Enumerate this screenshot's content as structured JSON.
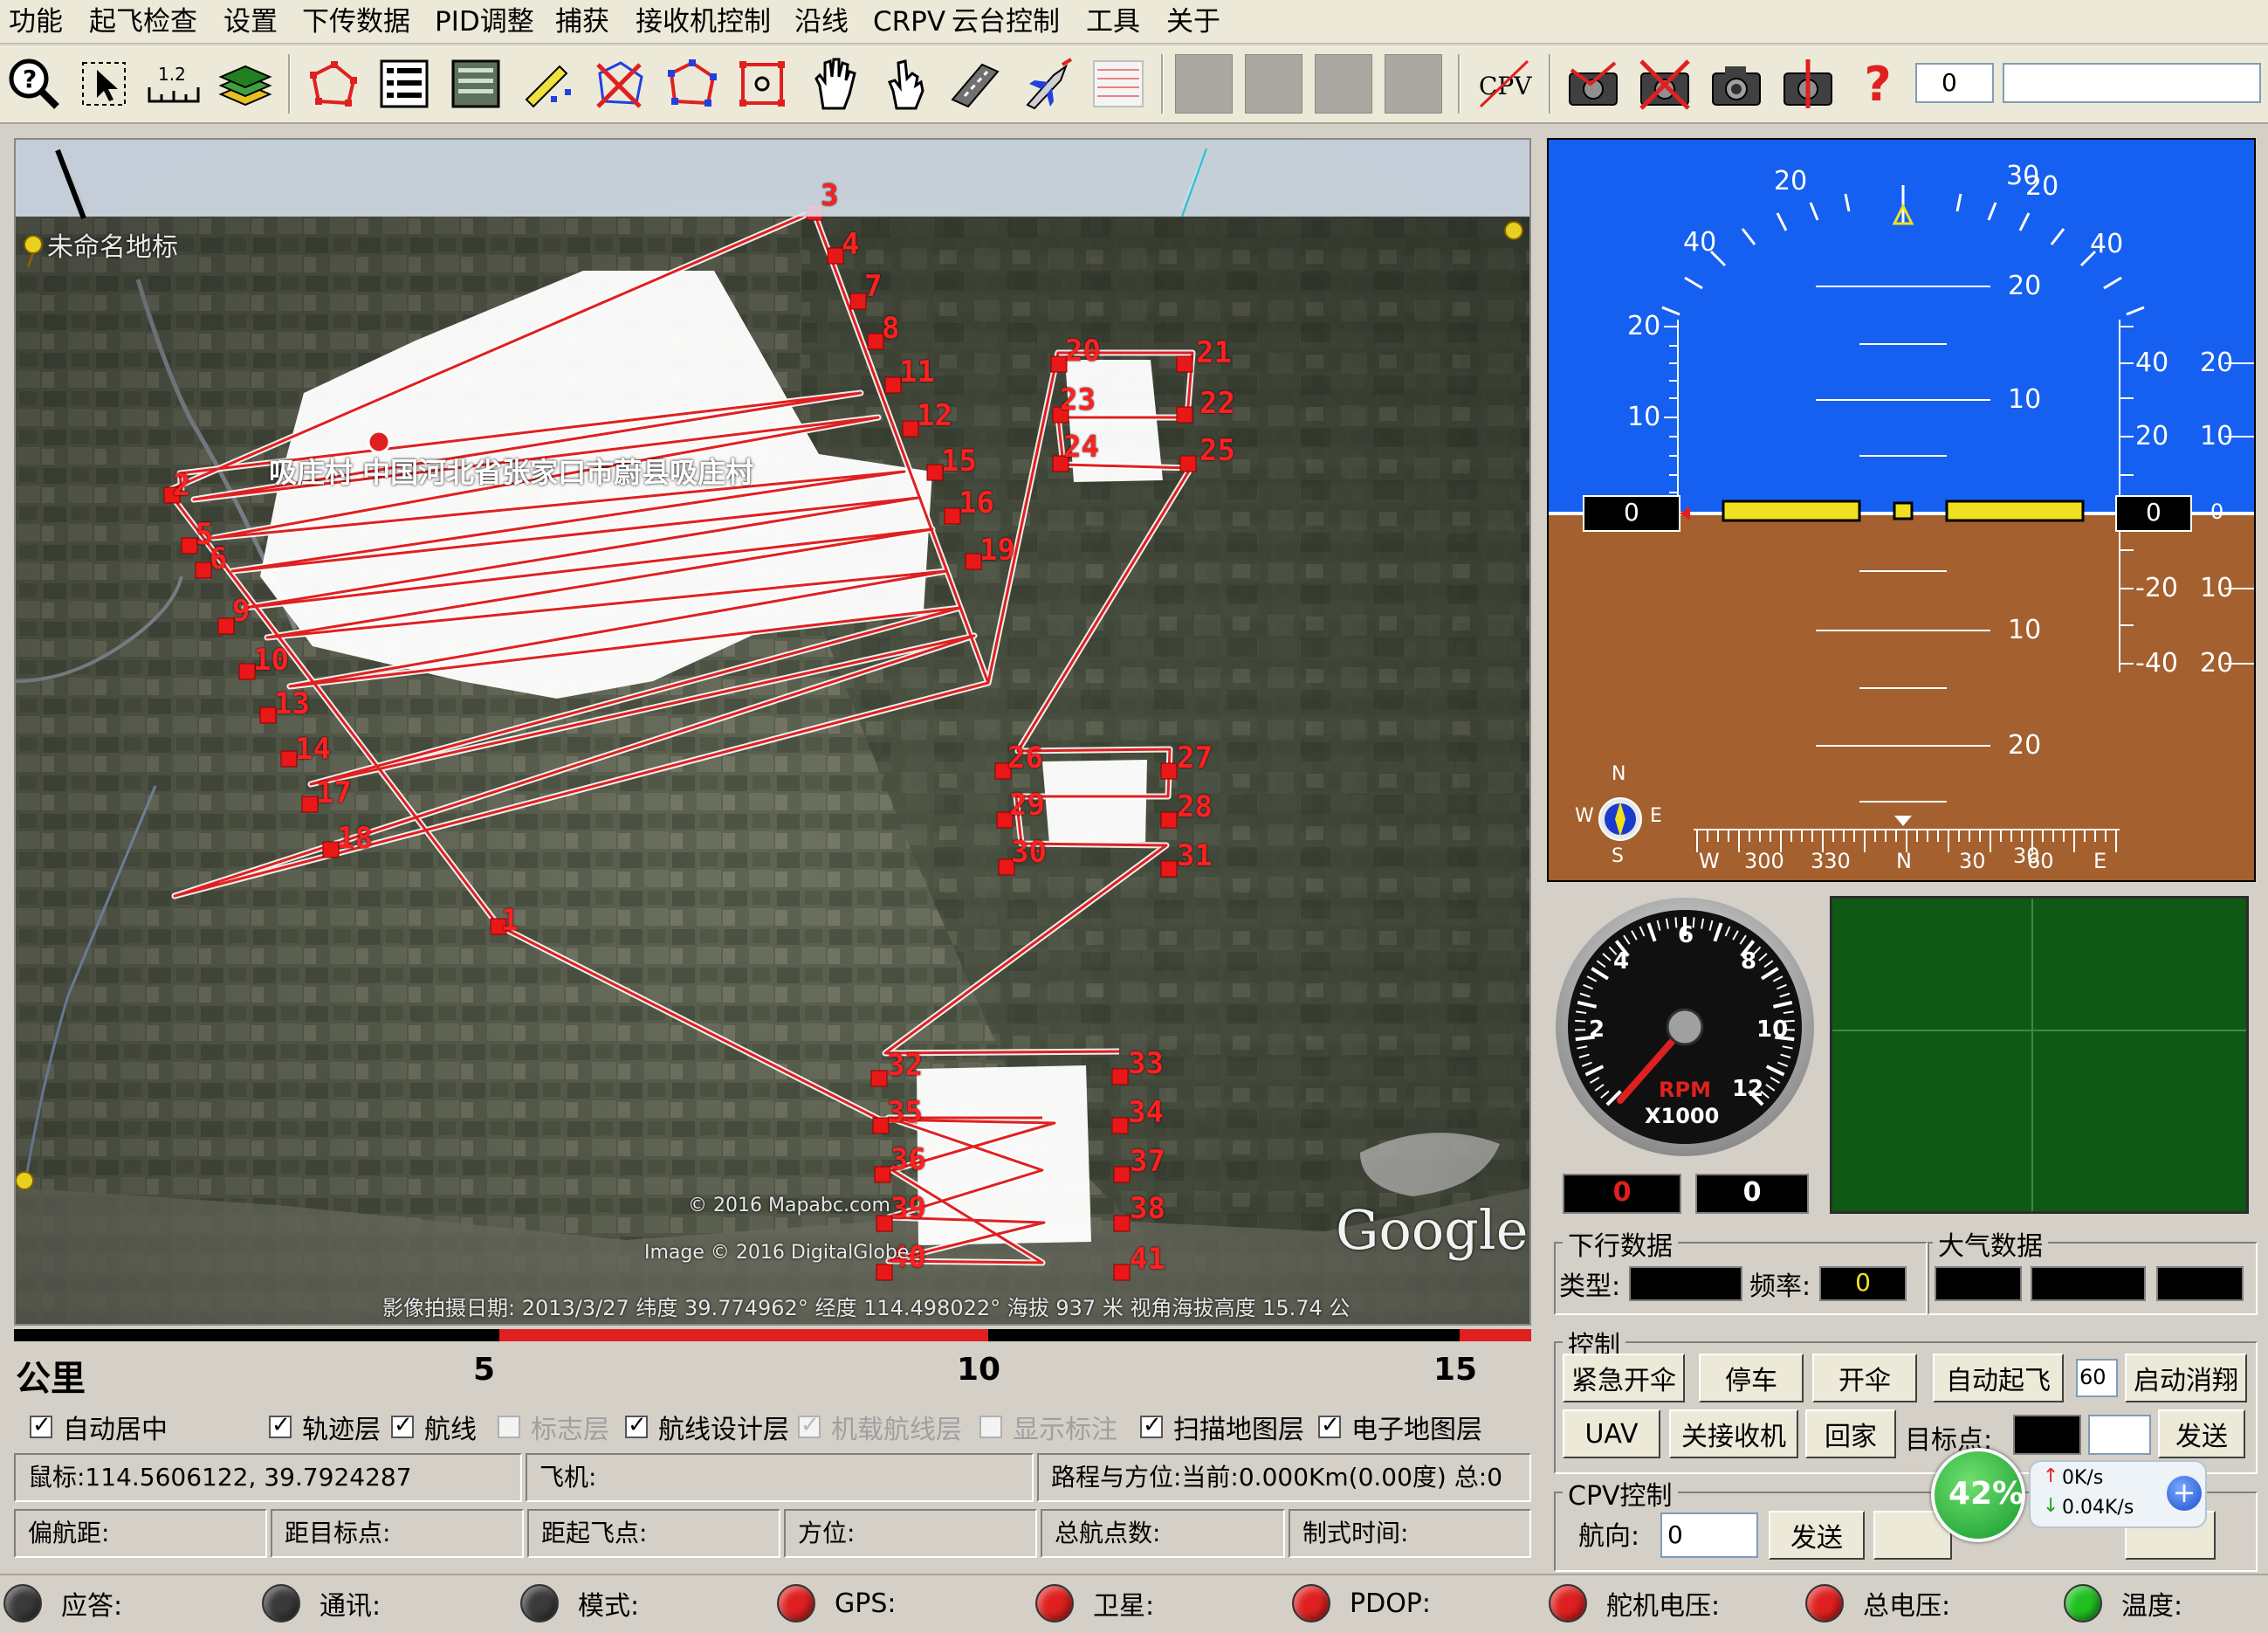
{
  "menu": [
    "功能",
    "起飞检查",
    "设置",
    "下传数据",
    "PID调整",
    "捕获",
    "接收机控制",
    "沿线",
    "CRPV",
    "云台控制",
    "工具",
    "关于"
  ],
  "toolbar": {
    "cpv_label": "CPV",
    "help_glyph": "?",
    "counter_value": "0",
    "text_value": ""
  },
  "map": {
    "location_label": "未命名地标",
    "place_label": "吸庄村 中国河北省张家口市蔚县吸庄村",
    "google": "Google",
    "copyright1": "© 2016 Mapabc.com",
    "copyright2": "Image © 2016 DigitalGlobe",
    "status_line": "影像拍摄日期: 2013/3/27   纬度  39.774962°  经度  114.498022°  海拔  937 米   视角海拔高度  15.74 公",
    "waypoint_labels": [
      "1",
      "2",
      "3",
      "4",
      "5",
      "6",
      "7",
      "8",
      "9",
      "10",
      "11",
      "12",
      "13",
      "14",
      "15",
      "16",
      "17",
      "18",
      "19",
      "20",
      "21",
      "22",
      "23",
      "24",
      "25",
      "26",
      "27",
      "28",
      "29",
      "30",
      "31",
      "32",
      "33",
      "34",
      "35",
      "36",
      "37",
      "38",
      "39",
      "40",
      "41"
    ]
  },
  "scale": {
    "unit": "公里",
    "ticks": [
      "5",
      "10",
      "15"
    ]
  },
  "layers": [
    {
      "label": "自动居中",
      "checked": true,
      "enabled": true
    },
    {
      "label": "轨迹层",
      "checked": true,
      "enabled": true
    },
    {
      "label": "航线",
      "checked": true,
      "enabled": true
    },
    {
      "label": "标志层",
      "checked": false,
      "enabled": false
    },
    {
      "label": "航线设计层",
      "checked": true,
      "enabled": true
    },
    {
      "label": "机载航线层",
      "checked": true,
      "enabled": false
    },
    {
      "label": "显示标注",
      "checked": false,
      "enabled": false
    },
    {
      "label": "扫描地图层",
      "checked": true,
      "enabled": true
    },
    {
      "label": "电子地图层",
      "checked": true,
      "enabled": true
    }
  ],
  "info": {
    "mouse": "鼠标:114.5606122, 39.7924287",
    "plane": "飞机:",
    "route": "路程与方位:当前:0.000Km(0.00度) 总:0",
    "offset": "偏航距:",
    "to_target": "距目标点:",
    "to_takeoff": "距起飞点:",
    "bearing": "方位:",
    "total_wp": "总航点数:",
    "fmt_time": "制式时间:"
  },
  "status": [
    {
      "label": "应答:",
      "color": "#3a3a3a"
    },
    {
      "label": "通讯:",
      "color": "#3a3a3a"
    },
    {
      "label": "模式:",
      "color": "#3a3a3a"
    },
    {
      "label": "GPS:",
      "color": "#e02020"
    },
    {
      "label": "卫星:",
      "color": "#e02020"
    },
    {
      "label": "PDOP:",
      "color": "#e02020"
    },
    {
      "label": "舵机电压:",
      "color": "#e02020"
    },
    {
      "label": "总电压:",
      "color": "#e02020"
    },
    {
      "label": "温度:",
      "color": "#20c020"
    }
  ],
  "adi": {
    "pitch_top_left": "20",
    "pitch_top_right": "30",
    "pitch_top_right2": "20",
    "roll_left_40": "40",
    "roll_right_40": "40",
    "pitch_up": [
      "20",
      "10"
    ],
    "pitch_down": [
      "10",
      "20"
    ],
    "left_alt": [
      "20",
      "10"
    ],
    "right_vs": [
      "40",
      "20",
      "20",
      "10",
      "-20",
      "10",
      "-40",
      "20"
    ],
    "alt_value": "0",
    "speed_value": "0",
    "vs_zero": "0",
    "compass": {
      "n": "N",
      "s": "S",
      "w": "W",
      "e": "E"
    },
    "heading_ticks": [
      "W",
      "300",
      "330",
      "N",
      "30",
      "60",
      "E"
    ],
    "heading_overlap": "30"
  },
  "rpm": {
    "ticks": [
      "2",
      "4",
      "6",
      "8",
      "10",
      "12"
    ],
    "label": "RPM",
    "unit": "X1000",
    "value_red": "0",
    "value_white": "0"
  },
  "downlink": {
    "title": "下行数据",
    "type_label": "类型:",
    "freq_label": "频率:",
    "freq_value": "0"
  },
  "air": {
    "title": "大气数据"
  },
  "control": {
    "title": "控制",
    "row1": [
      "紧急开伞",
      "停车",
      "开伞",
      "自动起飞"
    ],
    "input_60": "60",
    "cancel_hover": "启动消翔",
    "row2": [
      "UAV",
      "关接收机",
      "回家"
    ],
    "target_label": "目标点:",
    "send": "发送"
  },
  "cpv": {
    "title": "CPV控制",
    "heading_label": "航向:",
    "heading_value": "0",
    "send": "发送"
  },
  "net": {
    "percent": "42%",
    "up": "0K/s",
    "down": "0.04K/s"
  }
}
